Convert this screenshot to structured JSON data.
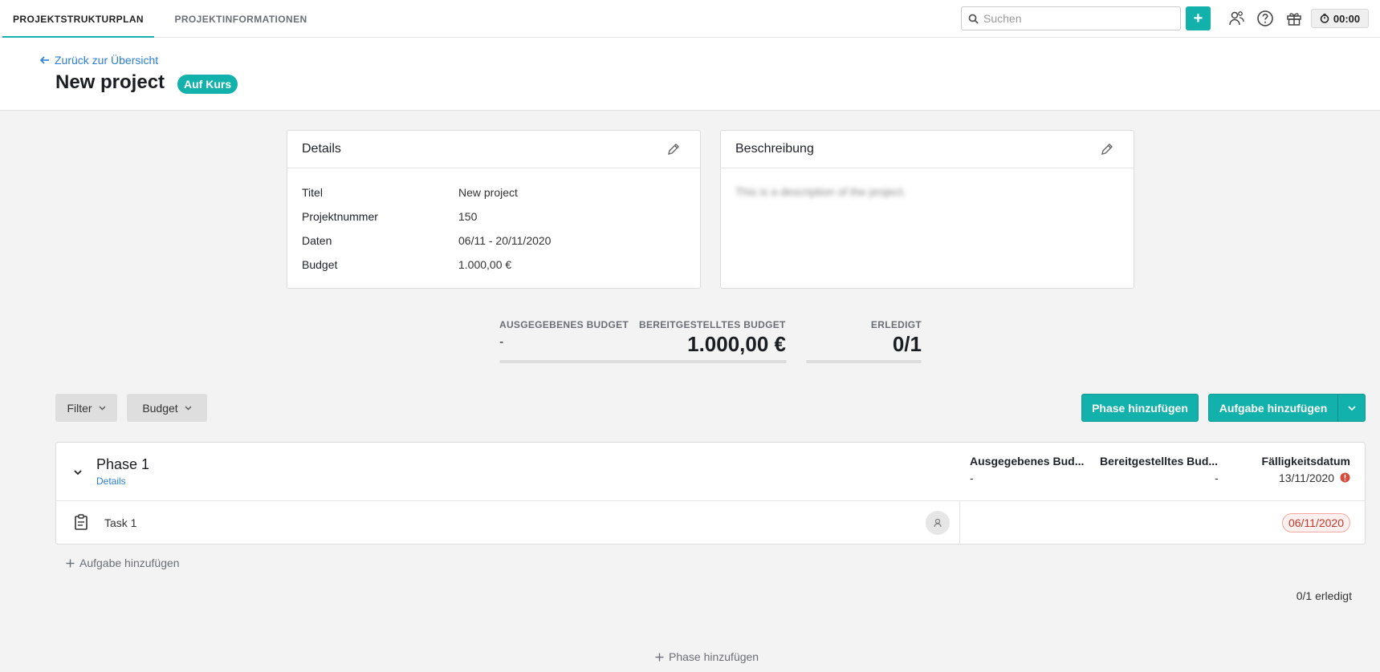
{
  "nav": {
    "tabs": [
      {
        "label": "PROJEKTSTRUKTURPLAN",
        "active": true
      },
      {
        "label": "PROJEKTINFORMATIONEN",
        "active": false
      }
    ],
    "search_placeholder": "Suchen",
    "add_label": "+",
    "timer": "00:00"
  },
  "header": {
    "back_label": "Zurück zur Übersicht",
    "title": "New project",
    "status": "Auf Kurs"
  },
  "details": {
    "title": "Details",
    "rows": [
      {
        "label": "Titel",
        "value": "New project"
      },
      {
        "label": "Projektnummer",
        "value": "150"
      },
      {
        "label": "Daten",
        "value": "06/11 - 20/11/2020"
      },
      {
        "label": "Budget",
        "value": "1.000,00 €"
      }
    ]
  },
  "description": {
    "title": "Beschreibung",
    "text": "This is a description of the project."
  },
  "stats": {
    "spent_label": "AUSGEGEBENES BUDGET",
    "spent_value": "-",
    "allocated_label": "BEREITGESTELLTES BUDGET",
    "allocated_value": "1.000,00 €",
    "done_label": "ERLEDIGT",
    "done_value": "0/1"
  },
  "toolbar": {
    "filter_label": "Filter",
    "budget_label": "Budget",
    "add_phase_label": "Phase hinzufügen",
    "add_task_label": "Aufgabe hinzufügen"
  },
  "phase": {
    "name": "Phase 1",
    "details_link": "Details",
    "col_spent": "Ausgegebenes Bud...",
    "col_allocated": "Bereitgestelltes Bud...",
    "col_due": "Fälligkeitsdatum",
    "spent": "-",
    "allocated": "-",
    "due": "13/11/2020",
    "tasks": [
      {
        "name": "Task 1",
        "due": "06/11/2020"
      }
    ],
    "add_task_label": "Aufgabe hinzufügen",
    "done_summary": "0/1 erledigt"
  },
  "footer": {
    "add_phase_label": "Phase hinzufügen"
  },
  "colors": {
    "accent": "#13b1ab",
    "link": "#2a7fd4",
    "overdue": "#c0392b"
  }
}
